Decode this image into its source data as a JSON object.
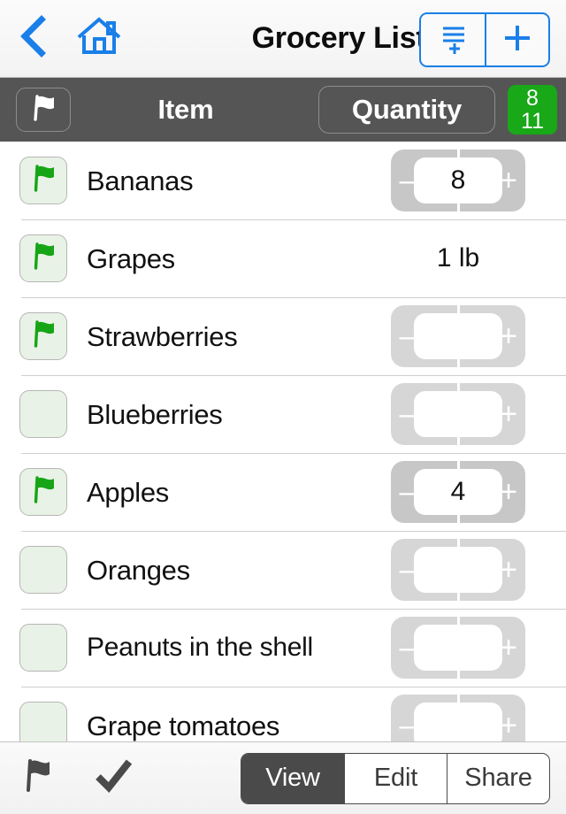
{
  "navbar": {
    "back_icon": "chevron-left-icon",
    "home_icon": "home-icon",
    "title": "Grocery List",
    "add_multiple_label": "add-multiple-lines-icon",
    "add_label": "plus-icon"
  },
  "column_header": {
    "flag_button_icon": "flag-icon",
    "item_label": "Item",
    "quantity_label": "Quantity",
    "badge": {
      "checked": "8",
      "total": "11",
      "color": "#18a818"
    }
  },
  "list": {
    "rows": [
      {
        "name": "Bananas",
        "flagged": true,
        "qty_type": "stepper",
        "value": "8",
        "minus": "–",
        "plus": "+"
      },
      {
        "name": "Grapes",
        "flagged": true,
        "qty_type": "text",
        "value": "1 lb"
      },
      {
        "name": "Strawberries",
        "flagged": true,
        "qty_type": "stepper",
        "value": "",
        "minus": "–",
        "plus": "+"
      },
      {
        "name": "Blueberries",
        "flagged": false,
        "qty_type": "stepper",
        "value": "",
        "minus": "–",
        "plus": "+"
      },
      {
        "name": "Apples",
        "flagged": true,
        "qty_type": "stepper",
        "value": "4",
        "minus": "–",
        "plus": "+"
      },
      {
        "name": "Oranges",
        "flagged": false,
        "qty_type": "stepper",
        "value": "",
        "minus": "–",
        "plus": "+"
      },
      {
        "name": "Peanuts in the shell",
        "flagged": false,
        "qty_type": "stepper",
        "value": "",
        "minus": "–",
        "plus": "+"
      },
      {
        "name": "Grape tomatoes",
        "flagged": false,
        "qty_type": "stepper",
        "value": "",
        "minus": "–",
        "plus": "+"
      }
    ]
  },
  "toolbar": {
    "flag_icon": "flag-icon",
    "check_icon": "checkmark-icon",
    "segments": [
      {
        "label": "View",
        "active": true
      },
      {
        "label": "Edit",
        "active": false
      },
      {
        "label": "Share",
        "active": false
      }
    ]
  },
  "colors": {
    "accent_blue": "#1a7fe8",
    "header_gray": "#555555",
    "flag_green": "#16a516",
    "badge_green": "#18a818"
  }
}
